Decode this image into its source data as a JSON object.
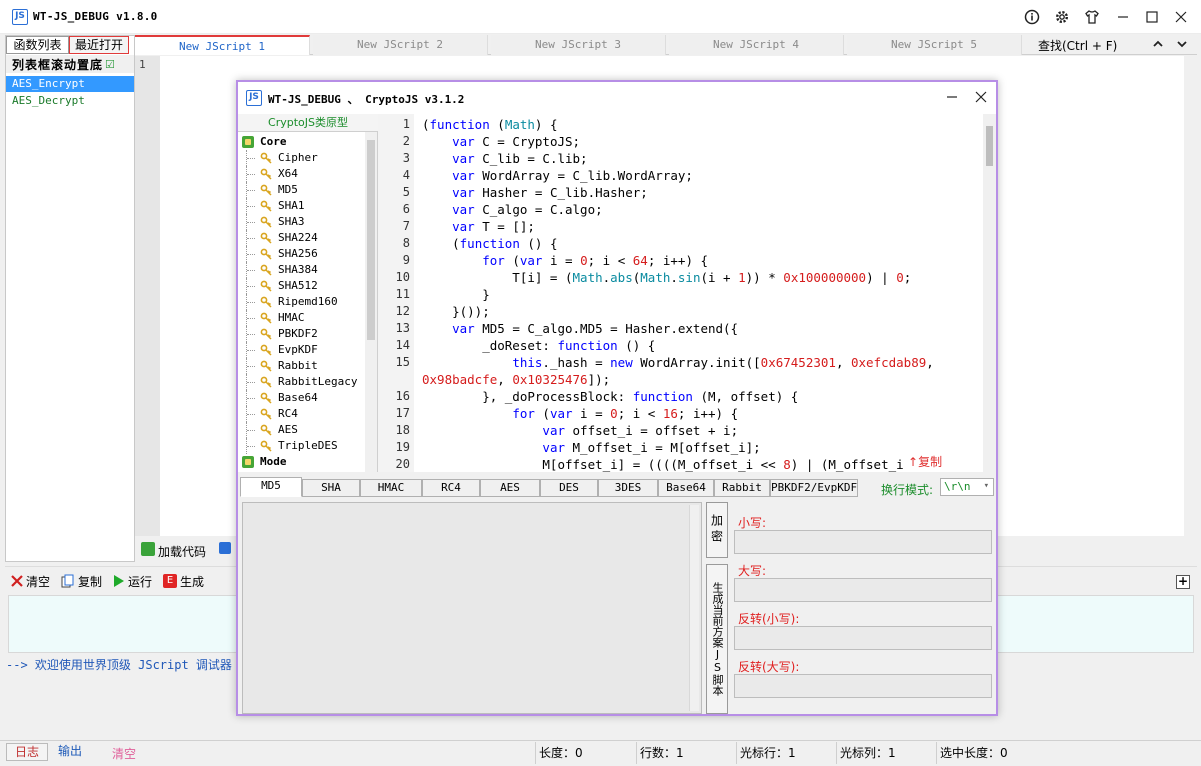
{
  "app": {
    "title": "WT-JS_DEBUG v1.8.0",
    "icon_label": "JS"
  },
  "left_panel": {
    "tabs": [
      "函数列表",
      "最近打开"
    ],
    "scroll_option": "列表框滚动置底",
    "scroll_checkmark": "☑",
    "functions": [
      "AES_Encrypt",
      "AES_Decrypt"
    ]
  },
  "file_tabs": [
    "New JScript 1",
    "New JScript 2",
    "New JScript 3",
    "New JScript 4",
    "New JScript 5"
  ],
  "search_label": "查找(Ctrl + F)",
  "editor": {
    "first_line_number": "1"
  },
  "load_bar": {
    "load_label": "加载代码",
    "extra_label": "I"
  },
  "output_toolbar": {
    "clear": "清空",
    "copy": "复制",
    "run": "运行",
    "generate": "生成"
  },
  "console_message": "--> 欢迎使用世界顶级 JScript 调试器 -",
  "bottom": {
    "tabs": [
      "日志",
      "输出"
    ],
    "clear": "清空",
    "stats": [
      "长度：0",
      "行数：1",
      "光标行：1",
      "光标列：1",
      "选中长度：0"
    ]
  },
  "dialog": {
    "title": "WT-JS_DEBUG 、 CryptoJS v3.1.2",
    "tree_header": "CryptoJS类原型",
    "tree": [
      {
        "label": "Core",
        "type": "category"
      },
      {
        "label": "Cipher",
        "type": "leaf"
      },
      {
        "label": "X64",
        "type": "leaf"
      },
      {
        "label": "MD5",
        "type": "leaf"
      },
      {
        "label": "SHA1",
        "type": "leaf"
      },
      {
        "label": "SHA3",
        "type": "leaf"
      },
      {
        "label": "SHA224",
        "type": "leaf"
      },
      {
        "label": "SHA256",
        "type": "leaf"
      },
      {
        "label": "SHA384",
        "type": "leaf"
      },
      {
        "label": "SHA512",
        "type": "leaf"
      },
      {
        "label": "Ripemd160",
        "type": "leaf"
      },
      {
        "label": "HMAC",
        "type": "leaf"
      },
      {
        "label": "PBKDF2",
        "type": "leaf"
      },
      {
        "label": "EvpKDF",
        "type": "leaf"
      },
      {
        "label": "Rabbit",
        "type": "leaf"
      },
      {
        "label": "RabbitLegacy",
        "type": "leaf"
      },
      {
        "label": "Base64",
        "type": "leaf"
      },
      {
        "label": "RC4",
        "type": "leaf"
      },
      {
        "label": "AES",
        "type": "leaf"
      },
      {
        "label": "TripleDES",
        "type": "leaf"
      },
      {
        "label": "Mode",
        "type": "category"
      }
    ],
    "code_line_numbers": [
      "1",
      "2",
      "3",
      "4",
      "5",
      "6",
      "7",
      "8",
      "9",
      "10",
      "11",
      "12",
      "13",
      "14",
      "15",
      "",
      "16",
      "17",
      "18",
      "19",
      "20"
    ],
    "code_lines": [
      [
        {
          "t": "(",
          "c": ""
        },
        {
          "t": "function",
          "c": "kw"
        },
        {
          "t": " (",
          "c": ""
        },
        {
          "t": "Math",
          "c": "cy"
        },
        {
          "t": ") {",
          "c": ""
        }
      ],
      [
        {
          "t": "    ",
          "c": ""
        },
        {
          "t": "var",
          "c": "kw"
        },
        {
          "t": " C = CryptoJS;",
          "c": ""
        }
      ],
      [
        {
          "t": "    ",
          "c": ""
        },
        {
          "t": "var",
          "c": "kw"
        },
        {
          "t": " C_lib = C.lib;",
          "c": ""
        }
      ],
      [
        {
          "t": "    ",
          "c": ""
        },
        {
          "t": "var",
          "c": "kw"
        },
        {
          "t": " WordArray = C_lib.WordArray;",
          "c": ""
        }
      ],
      [
        {
          "t": "    ",
          "c": ""
        },
        {
          "t": "var",
          "c": "kw"
        },
        {
          "t": " Hasher = C_lib.Hasher;",
          "c": ""
        }
      ],
      [
        {
          "t": "    ",
          "c": ""
        },
        {
          "t": "var",
          "c": "kw"
        },
        {
          "t": " C_algo = C.algo;",
          "c": ""
        }
      ],
      [
        {
          "t": "    ",
          "c": ""
        },
        {
          "t": "var",
          "c": "kw"
        },
        {
          "t": " T = [];",
          "c": ""
        }
      ],
      [
        {
          "t": "    (",
          "c": ""
        },
        {
          "t": "function",
          "c": "kw"
        },
        {
          "t": " () {",
          "c": ""
        }
      ],
      [
        {
          "t": "        ",
          "c": ""
        },
        {
          "t": "for",
          "c": "kw"
        },
        {
          "t": " (",
          "c": ""
        },
        {
          "t": "var",
          "c": "kw"
        },
        {
          "t": " i = ",
          "c": ""
        },
        {
          "t": "0",
          "c": "num"
        },
        {
          "t": "; i < ",
          "c": ""
        },
        {
          "t": "64",
          "c": "num"
        },
        {
          "t": "; i++) {",
          "c": ""
        }
      ],
      [
        {
          "t": "            T[i] = (",
          "c": ""
        },
        {
          "t": "Math",
          "c": "cy"
        },
        {
          "t": ".",
          "c": ""
        },
        {
          "t": "abs",
          "c": "cy"
        },
        {
          "t": "(",
          "c": ""
        },
        {
          "t": "Math",
          "c": "cy"
        },
        {
          "t": ".",
          "c": ""
        },
        {
          "t": "sin",
          "c": "cy"
        },
        {
          "t": "(i + ",
          "c": ""
        },
        {
          "t": "1",
          "c": "num"
        },
        {
          "t": ")) * ",
          "c": ""
        },
        {
          "t": "0x100000000",
          "c": "hex"
        },
        {
          "t": ") | ",
          "c": ""
        },
        {
          "t": "0",
          "c": "num"
        },
        {
          "t": ";",
          "c": ""
        }
      ],
      [
        {
          "t": "        }",
          "c": ""
        }
      ],
      [
        {
          "t": "    }());",
          "c": ""
        }
      ],
      [
        {
          "t": "    ",
          "c": ""
        },
        {
          "t": "var",
          "c": "kw"
        },
        {
          "t": " MD5 = C_algo.MD5 = Hasher.extend({",
          "c": ""
        }
      ],
      [
        {
          "t": "        _doReset: ",
          "c": ""
        },
        {
          "t": "function",
          "c": "kw"
        },
        {
          "t": " () {",
          "c": ""
        }
      ],
      [
        {
          "t": "            ",
          "c": ""
        },
        {
          "t": "this",
          "c": "kw"
        },
        {
          "t": "._hash = ",
          "c": ""
        },
        {
          "t": "new",
          "c": "kw"
        },
        {
          "t": " WordArray.init([",
          "c": ""
        },
        {
          "t": "0x67452301",
          "c": "hex"
        },
        {
          "t": ", ",
          "c": ""
        },
        {
          "t": "0xefcdab89",
          "c": "hex"
        },
        {
          "t": ",",
          "c": ""
        }
      ],
      [
        {
          "t": "0x98badcfe",
          "c": "hex"
        },
        {
          "t": ", ",
          "c": ""
        },
        {
          "t": "0x10325476",
          "c": "hex"
        },
        {
          "t": "]);",
          "c": ""
        }
      ],
      [
        {
          "t": "        }, _doProcessBlock: ",
          "c": ""
        },
        {
          "t": "function",
          "c": "kw"
        },
        {
          "t": " (M, offset) {",
          "c": ""
        }
      ],
      [
        {
          "t": "            ",
          "c": ""
        },
        {
          "t": "for",
          "c": "kw"
        },
        {
          "t": " (",
          "c": ""
        },
        {
          "t": "var",
          "c": "kw"
        },
        {
          "t": " i = ",
          "c": ""
        },
        {
          "t": "0",
          "c": "num"
        },
        {
          "t": "; i < ",
          "c": ""
        },
        {
          "t": "16",
          "c": "num"
        },
        {
          "t": "; i++) {",
          "c": ""
        }
      ],
      [
        {
          "t": "                ",
          "c": ""
        },
        {
          "t": "var",
          "c": "kw"
        },
        {
          "t": " offset_i = offset + i;",
          "c": ""
        }
      ],
      [
        {
          "t": "                ",
          "c": ""
        },
        {
          "t": "var",
          "c": "kw"
        },
        {
          "t": " M_offset_i = M[offset_i];",
          "c": ""
        }
      ],
      [
        {
          "t": "                M[offset_i] = ((((M_offset_i << ",
          "c": ""
        },
        {
          "t": "8",
          "c": "num"
        },
        {
          "t": ") | (M_offset_i >",
          "c": ""
        }
      ]
    ],
    "copy_link": "复制",
    "copy_arrow": "↑",
    "algo_tabs": [
      "MD5",
      "SHA",
      "HMAC",
      "RC4",
      "AES",
      "DES",
      "3DES",
      "Base64",
      "Rabbit",
      "PBKDF2/EvpKDF"
    ],
    "newline_mode_label": "换行模式:",
    "newline_mode_value": "\\r\\n",
    "encrypt_button": "加密",
    "generate_script_button": "生成当前方案JS脚本",
    "outputs": [
      "小写:",
      "大写:",
      "反转(小写):",
      "反转(大写):"
    ]
  },
  "colors": {
    "accent_blue": "#2b6fd6",
    "dialog_border": "#b78ee6",
    "green": "#1b8d2b",
    "red": "#e02020"
  }
}
